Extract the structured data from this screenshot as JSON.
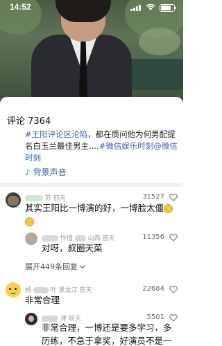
{
  "status_bar": {
    "time": "14:52"
  },
  "sheet": {
    "title": "评论 7364"
  },
  "caption": {
    "tag1": "#王阳评论区沦陷",
    "text": "，都在质问他为何男配提名白玉兰最佳男主....",
    "tag2": "#微信娱乐时刻@微信时刻"
  },
  "music": {
    "label": "背景声音"
  },
  "comments": [
    {
      "author": "苏",
      "time": "前天",
      "likes": "31527",
      "text": "其实王阳比一博演的好，一博脸太僵",
      "replies": [
        {
          "author": "怜惜",
          "location": "山西",
          "time": "前天",
          "likes": "11356",
          "text": "对呀，叔圈天菜"
        }
      ],
      "expand_label": "展开449条回复"
    },
    {
      "author": "杨",
      "name_tail": "叶",
      "location": "黑龙江",
      "time": "前天",
      "likes": "22684",
      "text": "非常合理",
      "replies": [
        {
          "author": "津",
          "time": "前天",
          "likes": "5501",
          "text": "非常合理，一博还是要多学习，多历练，不急于拿奖，好演员不是一两天"
        }
      ]
    }
  ],
  "colors": {
    "link": "#3f66a8",
    "music_note": "#1aad52"
  }
}
